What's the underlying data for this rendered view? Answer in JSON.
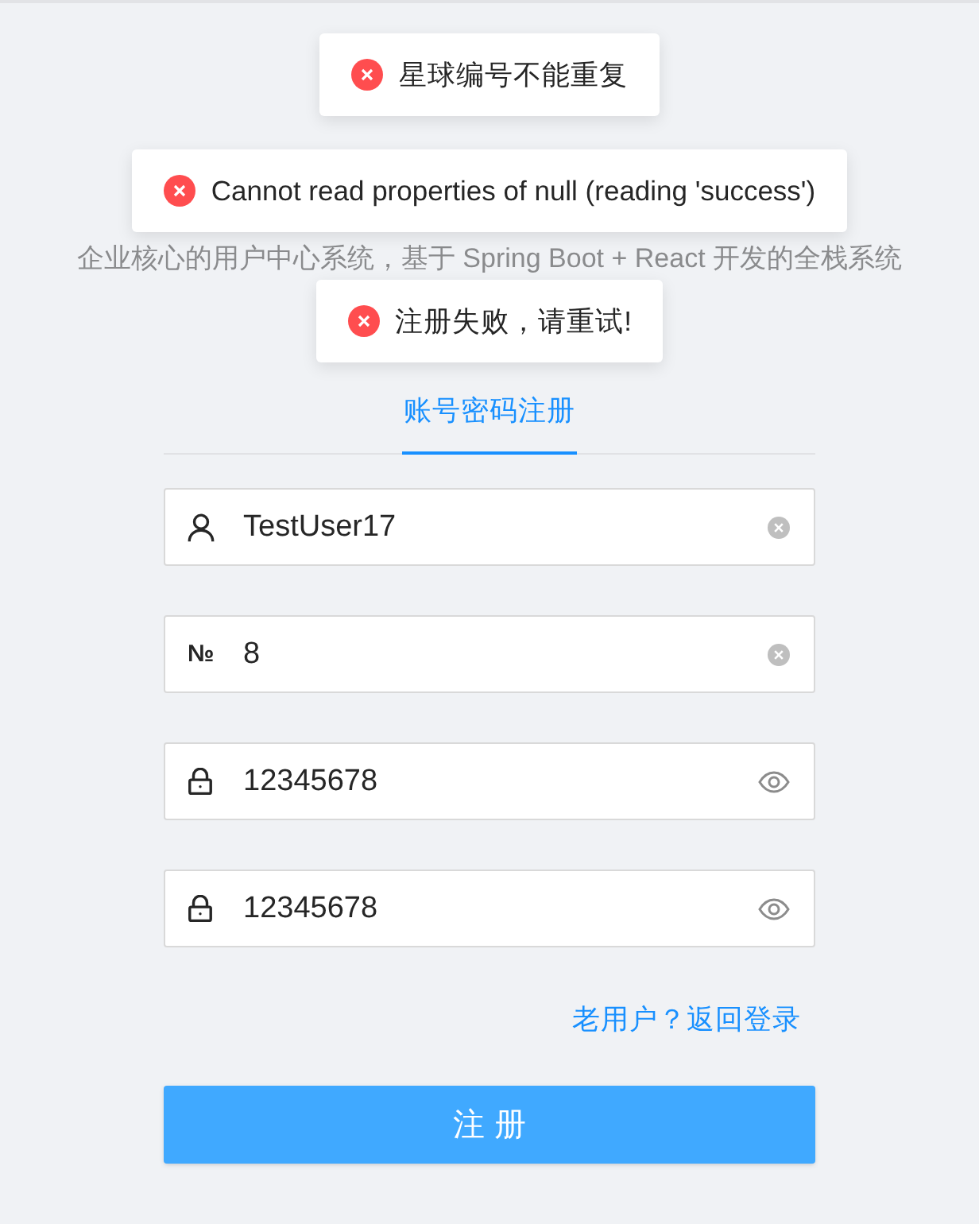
{
  "toasts": [
    {
      "kind": "error",
      "text": "星球编号不能重复"
    },
    {
      "kind": "error",
      "text": "Cannot read properties of null (reading 'success')"
    },
    {
      "kind": "error",
      "text": "注册失败，请重试!"
    }
  ],
  "subtitle": "企业核心的用户中心系统，基于 Spring Boot + React 开发的全栈系统",
  "tabs": [
    {
      "label": "账号密码注册",
      "selected": true
    }
  ],
  "fields": [
    {
      "kind": "username",
      "value": "TestUser17"
    },
    {
      "kind": "number",
      "prefix": "№",
      "value": "8"
    },
    {
      "kind": "password",
      "value": "12345678"
    },
    {
      "kind": "password",
      "value": "12345678"
    }
  ],
  "login_link": "老用户？返回登录",
  "submit_button": "注 册"
}
